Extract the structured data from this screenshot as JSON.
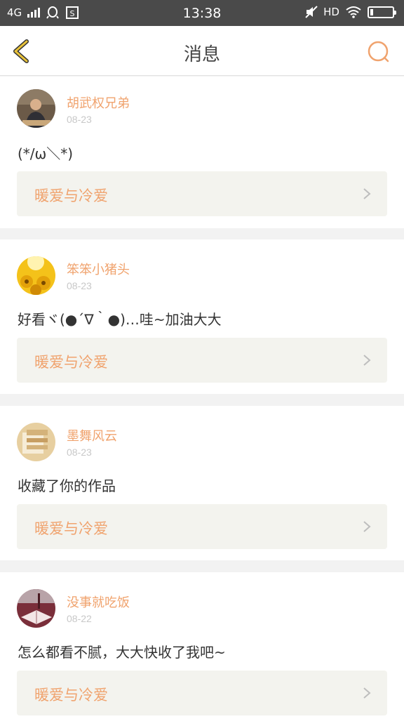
{
  "statusbar": {
    "network": "4G",
    "time": "13:38",
    "hd": "HD",
    "icons": [
      "signal-icon",
      "qq-icon",
      "sim-icon",
      "mute-icon",
      "wifi-icon",
      "battery-icon"
    ]
  },
  "header": {
    "title": "消息",
    "back_icon": "chevron-left-icon",
    "search_icon": "search-icon"
  },
  "colors": {
    "accent": "#f0a36e",
    "back": "#e8c23a",
    "statusbar": "#4a4a4a",
    "card_inner": "#f3f3ee"
  },
  "messages": [
    {
      "user": "胡武权兄弟",
      "date": "08-23",
      "text": "(*/ω＼*)",
      "work": "暖爱与冷爱"
    },
    {
      "user": "笨笨小猪头",
      "date": "08-23",
      "text": "好看ヾ(●´∇｀●)…哇~加油大大",
      "work": "暖爱与冷爱"
    },
    {
      "user": "墨舞风云",
      "date": "08-23",
      "text": "收藏了你的作品",
      "work": "暖爱与冷爱"
    },
    {
      "user": "没事就吃饭",
      "date": "08-22",
      "text": "怎么都看不腻，大大快收了我吧~",
      "work": "暖爱与冷爱"
    }
  ]
}
